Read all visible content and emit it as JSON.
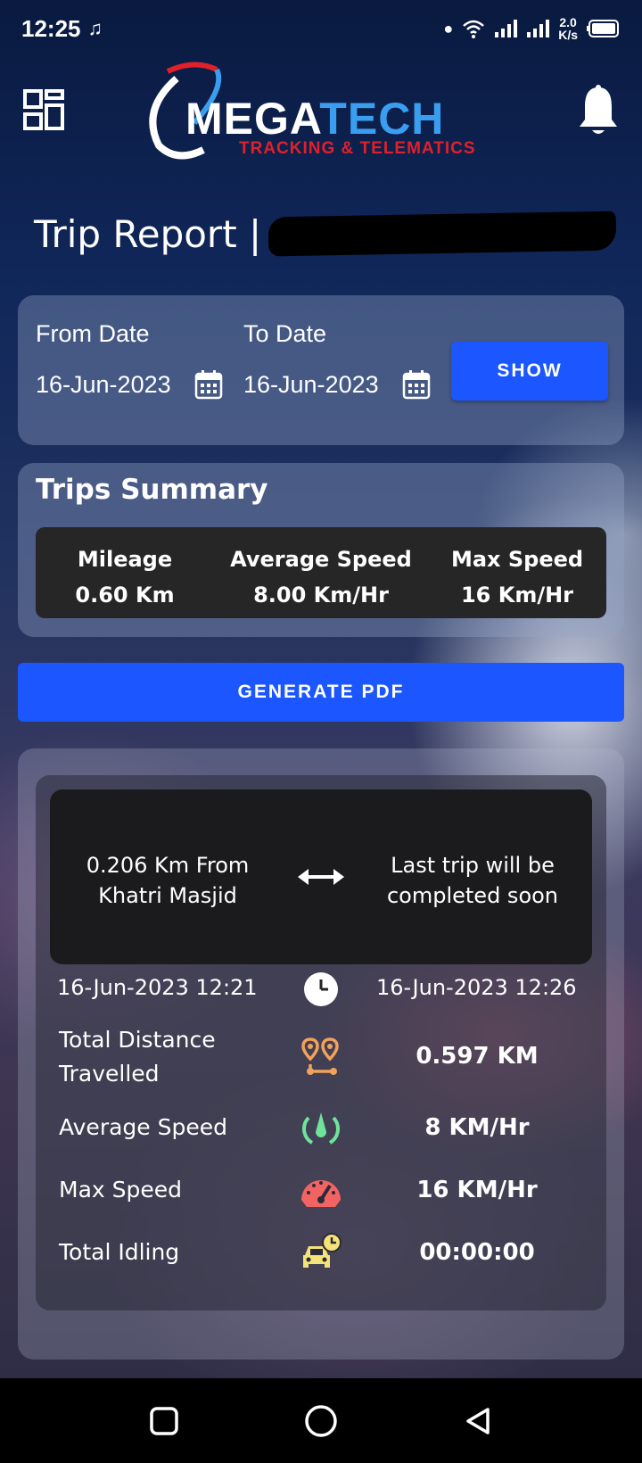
{
  "status_bar": {
    "time": "12:25",
    "net_speed_value": "2.0",
    "net_speed_unit": "K/s"
  },
  "header": {
    "logo_mega": "MEGA",
    "logo_tech": "TECH",
    "logo_sub": "TRACKING & TELEMATICS",
    "menu_icon": "grid-menu-icon",
    "notification_icon": "bell-icon"
  },
  "page": {
    "title": "Trip Report |"
  },
  "date_filter": {
    "from_label": "From Date",
    "from_value": "16-Jun-2023",
    "to_label": "To Date",
    "to_value": "16-Jun-2023",
    "show_label": "SHOW"
  },
  "summary": {
    "title": "Trips Summary",
    "items": [
      {
        "label": "Mileage",
        "value": "0.60 Km"
      },
      {
        "label": "Average Speed",
        "value": "8.00 Km/Hr"
      },
      {
        "label": "Max Speed",
        "value": "16 Km/Hr"
      }
    ]
  },
  "generate_pdf_label": "GENERATE PDF",
  "trip": {
    "from_text": "0.206 Km From Khatri Masjid",
    "to_text": "Last trip will be completed soon",
    "start_time": "16-Jun-2023 12:21",
    "end_time": "16-Jun-2023 12:26",
    "stats": [
      {
        "label": "Total Distance Travelled",
        "value": "0.597 KM",
        "icon": "route-pin-icon",
        "color": "#f2a25a"
      },
      {
        "label": "Average Speed",
        "value": "8 KM/Hr",
        "icon": "speed-drop-icon",
        "color": "#6fe39a"
      },
      {
        "label": "Max Speed",
        "value": "16 KM/Hr",
        "icon": "speedometer-icon",
        "color": "#f26464"
      },
      {
        "label": "Total Idling",
        "value": "00:00:00",
        "icon": "car-clock-icon",
        "color": "#f4e27a"
      }
    ]
  },
  "colors": {
    "accent_button": "#1b56ff",
    "logo_red": "#e0202a",
    "logo_blue": "#3a9ef0"
  }
}
